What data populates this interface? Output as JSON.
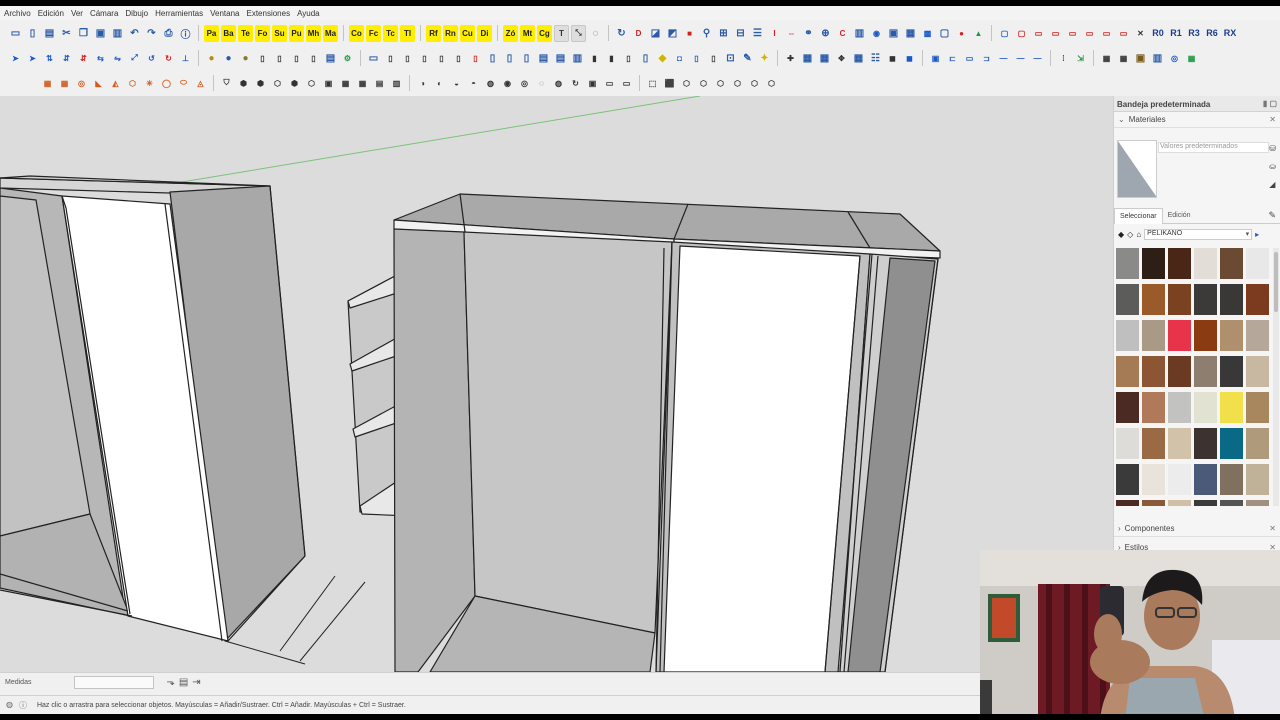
{
  "menu": [
    "Archivo",
    "Edición",
    "Ver",
    "Cámara",
    "Dibujo",
    "Herramientas",
    "Ventana",
    "Extensiones",
    "Ayuda"
  ],
  "toolbar1": {
    "yellow_buttons": [
      "Pa",
      "Ba",
      "Te",
      "Fo",
      "Su",
      "Pu",
      "Mh",
      "Ma",
      "Co",
      "Fc",
      "Tc",
      "Tl",
      "Rf",
      "Rn",
      "Cu",
      "Di",
      "Zó",
      "Mt",
      "Cg"
    ],
    "right_labels": [
      "R0",
      "R1",
      "R3",
      "R6",
      "RX"
    ]
  },
  "tray": {
    "title": "Bandeja predeterminada",
    "materials_panel": {
      "header": "Materiales",
      "material_name_placeholder": "Valores predeterminados",
      "tabs": [
        "Seleccionar",
        "Edición"
      ],
      "library": "PELIKANO",
      "swatch_colors": [
        "#8a8a88",
        "#2e1f16",
        "#4a2616",
        "#e2ddd6",
        "#6b4a34",
        "#e8e8e8",
        "#5c5c5a",
        "#9a5a2a",
        "#7a4220",
        "#3c3a38",
        "#3a3836",
        "#7c3a1e",
        "#bfbfbf",
        "#a89a84",
        "#e8344a",
        "#8a3b12",
        "#b08f6e",
        "#b5a89a",
        "#a57b56",
        "#8c5634",
        "#6a3a22",
        "#8e7e70",
        "#383838",
        "#c8b8a2",
        "#4a2a22",
        "#b07a5a",
        "#c2c2c0",
        "#e2e2d2",
        "#f2e04a",
        "#a8875e",
        "#dedcd8",
        "#9a6a44",
        "#d2c2aa",
        "#3c3230",
        "#0a6a86",
        "#b09a7c",
        "#3a3a3a",
        "#e8e4dc",
        "#ececec",
        "#4a5a78",
        "#807060",
        "#c0b298",
        "#4a2a22",
        "#8a5a3a",
        "#d0c0a8",
        "#3a3a3a",
        "#545454",
        "#a09080"
      ]
    },
    "components_header": "Componentes",
    "styles_header": "Estilos"
  },
  "measurements": {
    "label": "Medidas",
    "value": ""
  },
  "status": {
    "message": "Haz clic o arrastra para seleccionar objetos. Mayúsculas = Añadir/Sustraer. Ctrl = Añadir. Mayúsculas + Ctrl = Sustraer."
  }
}
